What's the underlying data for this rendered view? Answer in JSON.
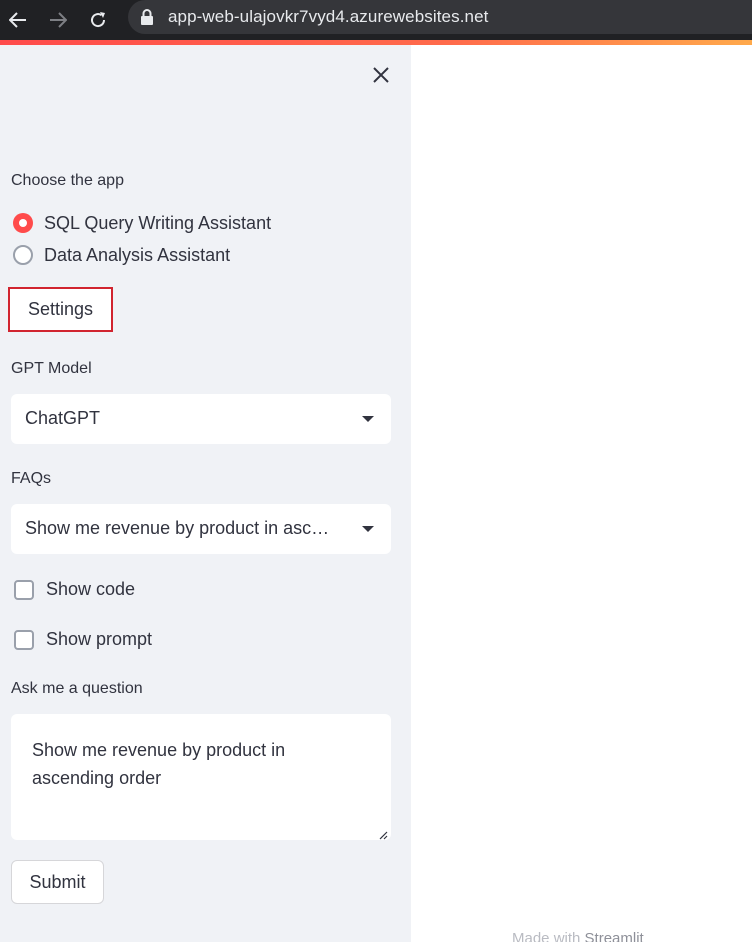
{
  "browser": {
    "url": "app-web-ulajovkr7vyd4.azurewebsites.net"
  },
  "sidebar": {
    "choose_label": "Choose the app",
    "apps": [
      {
        "label": "SQL Query Writing Assistant",
        "selected": true
      },
      {
        "label": "Data Analysis Assistant",
        "selected": false
      }
    ],
    "settings_label": "Settings",
    "gpt_model_label": "GPT Model",
    "gpt_model_value": "ChatGPT",
    "faqs_label": "FAQs",
    "faqs_value": "Show me revenue by product in asc…",
    "show_code_label": "Show code",
    "show_prompt_label": "Show prompt",
    "question_label": "Ask me a question",
    "question_value": "Show me revenue by product in ascending order",
    "submit_label": "Submit"
  },
  "footer": {
    "made_with": "Made with",
    "brand": "Streamlit"
  },
  "colors": {
    "accent": "#ff4b4b",
    "sidebar_bg": "#f0f2f6",
    "highlight_border": "#d1242f"
  }
}
